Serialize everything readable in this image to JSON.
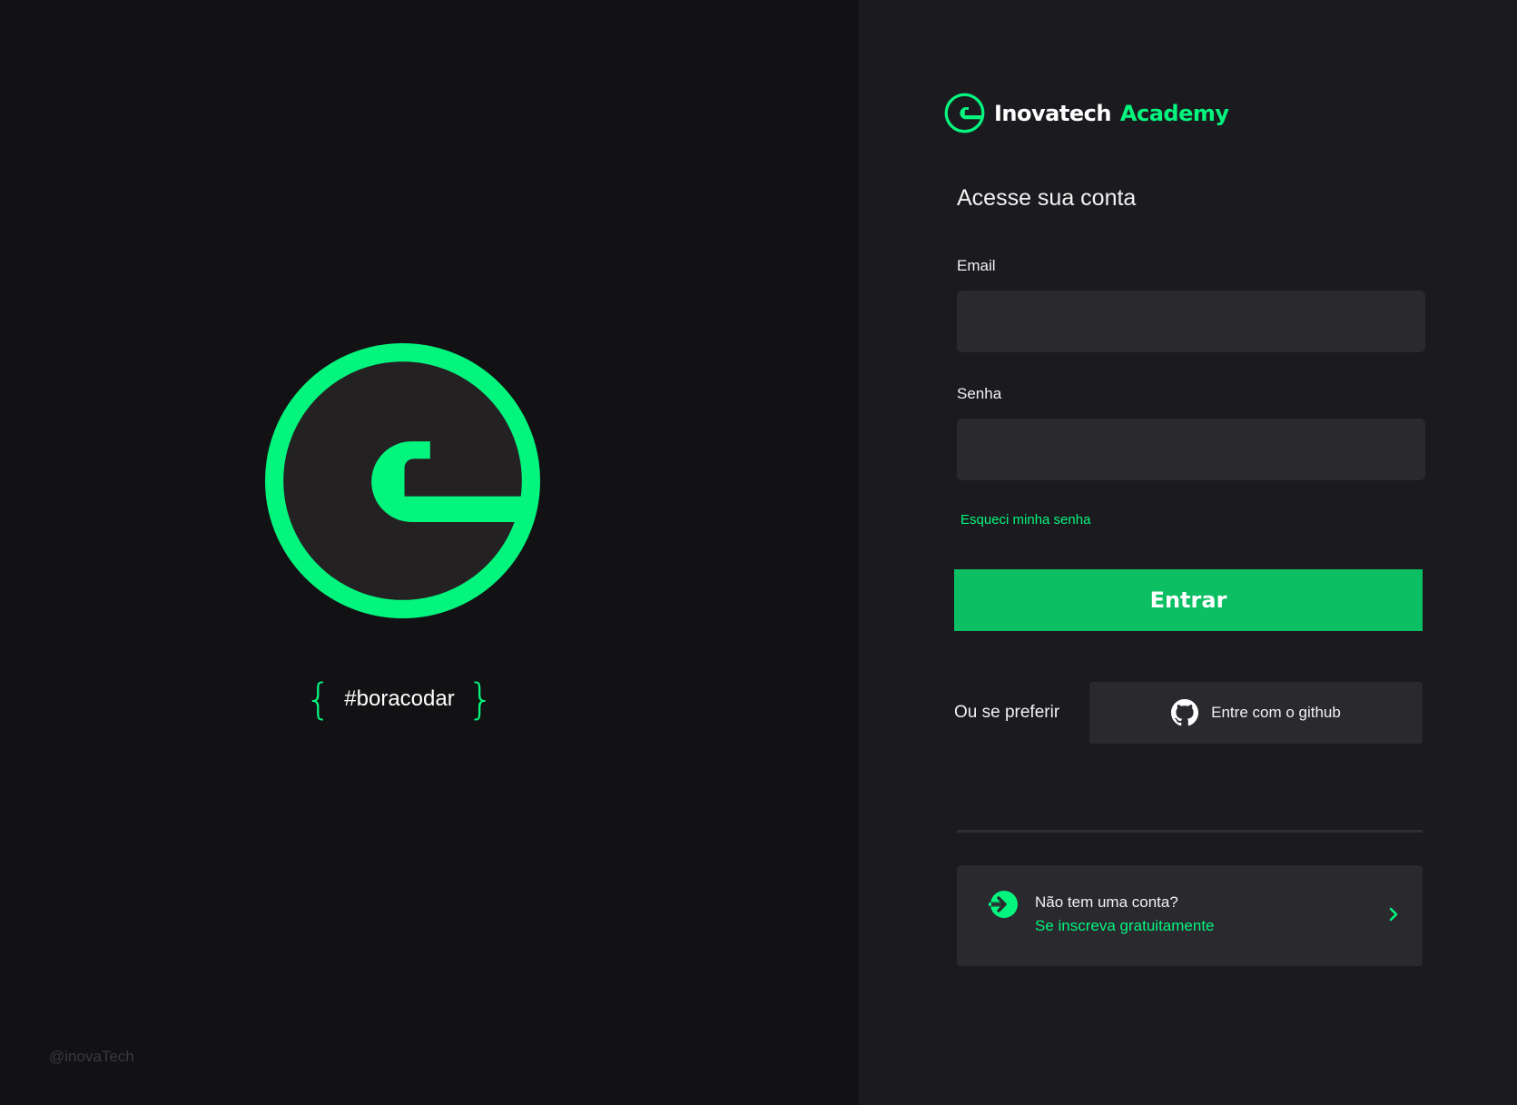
{
  "hero": {
    "tagline": "#boracodar",
    "handle": "@inovaTech"
  },
  "brand": {
    "name": "Inovatech",
    "accent": "Academy"
  },
  "form": {
    "title": "Acesse sua conta",
    "email_label": "Email",
    "email_value": "",
    "password_label": "Senha",
    "password_value": "",
    "forgot_link": "Esqueci minha senha",
    "submit_label": "Entrar"
  },
  "social": {
    "prompt": "Ou se preferir",
    "github_label": "Entre com o github",
    "icon": "github-icon"
  },
  "signup": {
    "question": "Não tem uma conta?",
    "link": "Se inscreva gratuitamente",
    "icon": "sign-in-arrow-icon"
  },
  "colors": {
    "accent": "#04f57e",
    "button": "#0bbf62",
    "left_bg": "#121214",
    "right_bg": "#1b1b1f",
    "input_bg": "#29292e"
  }
}
